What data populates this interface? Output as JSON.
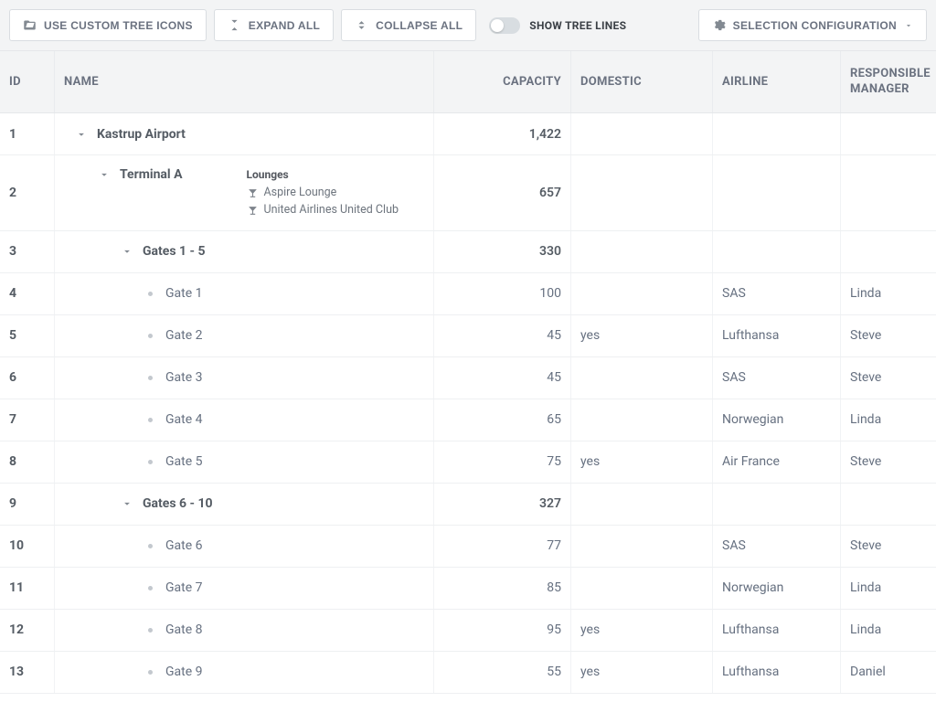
{
  "toolbar": {
    "custom_icons": "USE CUSTOM TREE ICONS",
    "expand_all": "EXPAND ALL",
    "collapse_all": "COLLAPSE ALL",
    "show_tree_lines": "SHOW TREE LINES",
    "selection_config": "SELECTION CONFIGURATION"
  },
  "columns": {
    "id": "ID",
    "name": "NAME",
    "capacity": "CAPACITY",
    "domestic": "DOMESTIC",
    "airline": "AIRLINE",
    "manager": "RESPONSIBLE MANAGER"
  },
  "lounges_heading": "Lounges",
  "lounges_list": {
    "0": "Aspire Lounge",
    "1": "United Airlines United Club"
  },
  "rows": {
    "0": {
      "id": "1",
      "name": "Kastrup Airport",
      "capacity": "1,422",
      "domestic": "",
      "airline": "",
      "manager": "",
      "level": 0,
      "type": "branch"
    },
    "1": {
      "id": "2",
      "name": "Terminal A",
      "capacity": "657",
      "domestic": "",
      "airline": "",
      "manager": "",
      "level": 1,
      "type": "branch"
    },
    "2": {
      "id": "3",
      "name": "Gates 1 - 5",
      "capacity": "330",
      "domestic": "",
      "airline": "",
      "manager": "",
      "level": 2,
      "type": "branch"
    },
    "3": {
      "id": "4",
      "name": "Gate 1",
      "capacity": "100",
      "domestic": "",
      "airline": "SAS",
      "manager": "Linda",
      "level": 3,
      "type": "leaf"
    },
    "4": {
      "id": "5",
      "name": "Gate 2",
      "capacity": "45",
      "domestic": "yes",
      "airline": "Lufthansa",
      "manager": "Steve",
      "level": 3,
      "type": "leaf"
    },
    "5": {
      "id": "6",
      "name": "Gate 3",
      "capacity": "45",
      "domestic": "",
      "airline": "SAS",
      "manager": "Steve",
      "level": 3,
      "type": "leaf"
    },
    "6": {
      "id": "7",
      "name": "Gate 4",
      "capacity": "65",
      "domestic": "",
      "airline": "Norwegian",
      "manager": "Linda",
      "level": 3,
      "type": "leaf"
    },
    "7": {
      "id": "8",
      "name": "Gate 5",
      "capacity": "75",
      "domestic": "yes",
      "airline": "Air France",
      "manager": "Steve",
      "level": 3,
      "type": "leaf"
    },
    "8": {
      "id": "9",
      "name": "Gates 6 - 10",
      "capacity": "327",
      "domestic": "",
      "airline": "",
      "manager": "",
      "level": 2,
      "type": "branch"
    },
    "9": {
      "id": "10",
      "name": "Gate 6",
      "capacity": "77",
      "domestic": "",
      "airline": "SAS",
      "manager": "Steve",
      "level": 3,
      "type": "leaf"
    },
    "10": {
      "id": "11",
      "name": "Gate 7",
      "capacity": "85",
      "domestic": "",
      "airline": "Norwegian",
      "manager": "Linda",
      "level": 3,
      "type": "leaf"
    },
    "11": {
      "id": "12",
      "name": "Gate 8",
      "capacity": "95",
      "domestic": "yes",
      "airline": "Lufthansa",
      "manager": "Linda",
      "level": 3,
      "type": "leaf"
    },
    "12": {
      "id": "13",
      "name": "Gate 9",
      "capacity": "55",
      "domestic": "yes",
      "airline": "Lufthansa",
      "manager": "Daniel",
      "level": 3,
      "type": "leaf"
    }
  }
}
